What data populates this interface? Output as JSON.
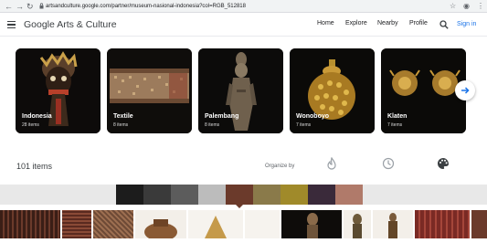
{
  "browser": {
    "url": "artsandculture.google.com/partner/museum-nasional-indonesia?col=RGB_512818"
  },
  "header": {
    "logo_text": "Google Arts & Culture",
    "nav": [
      "Home",
      "Explore",
      "Nearby",
      "Profile"
    ],
    "signin_label": "Sign in"
  },
  "cards": [
    {
      "title": "Indonesia",
      "count": "28 items"
    },
    {
      "title": "Textile",
      "count": "8 items"
    },
    {
      "title": "Palembang",
      "count": "8 items"
    },
    {
      "title": "Wonoboyo",
      "count": "7 items"
    },
    {
      "title": "Klaten",
      "count": "7 items"
    }
  ],
  "collection": {
    "items_count": "101 items",
    "organize_label": "Organize by",
    "organize_options": [
      "popularity-flame-icon",
      "time-clock-icon",
      "color-palette-icon"
    ]
  },
  "color_filter": {
    "swatches": [
      "#1c1c1c",
      "#3a3a3a",
      "#5c5c5c",
      "#bcbcbc",
      "#6b3a2b",
      "#8a7a4a",
      "#a08a2a",
      "#3a2a3a",
      "#b07a6a"
    ],
    "selected_index": 4
  }
}
